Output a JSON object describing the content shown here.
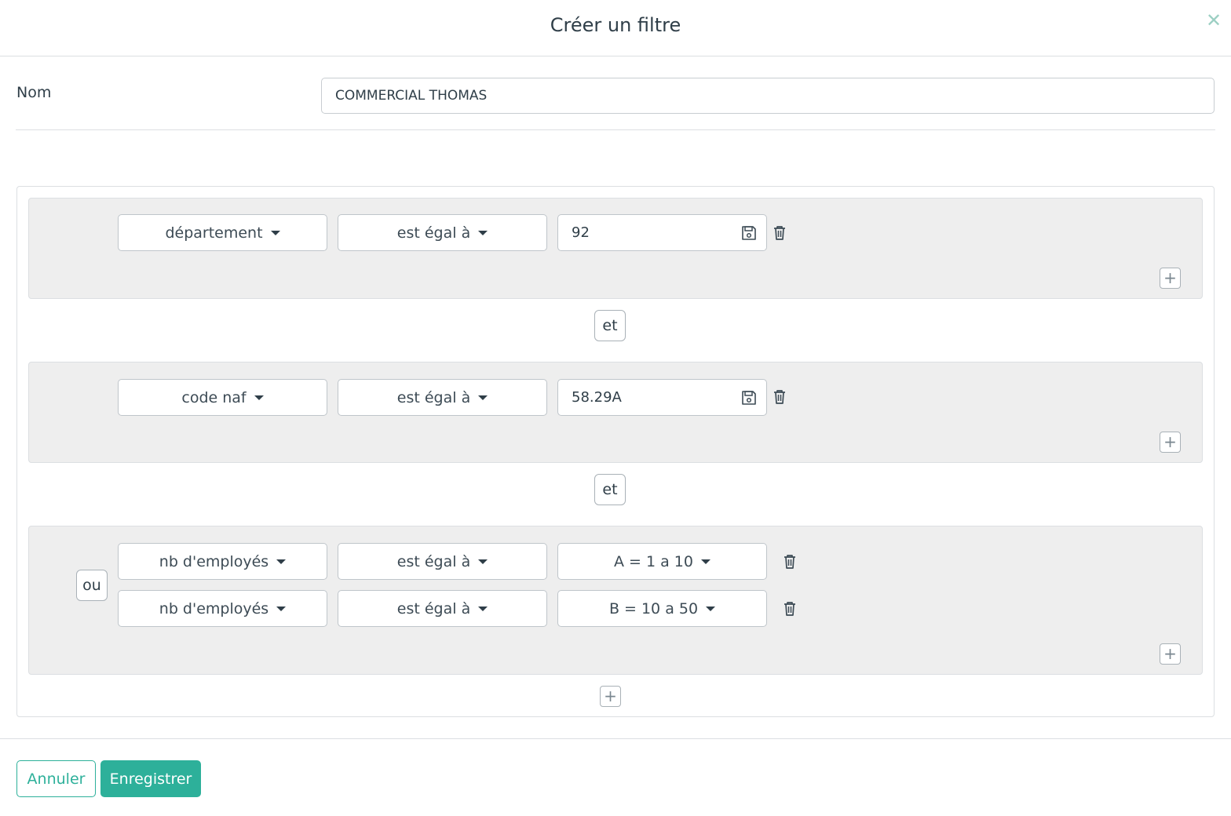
{
  "dialog": {
    "title": "Créer un filtre",
    "close_icon": "close-icon"
  },
  "form": {
    "name_label": "Nom",
    "name_value": "COMMERCIAL THOMAS"
  },
  "groups": [
    {
      "rules": [
        {
          "field": "département",
          "operator": "est égal à",
          "value": "92",
          "value_type": "text"
        }
      ]
    },
    {
      "rules": [
        {
          "field": "code naf",
          "operator": "est égal à",
          "value": "58.29A",
          "value_type": "text"
        }
      ]
    },
    {
      "combinator": "ou",
      "rules": [
        {
          "field": "nb d'employés",
          "operator": "est égal à",
          "value": "A = 1 a 10",
          "value_type": "select"
        },
        {
          "field": "nb d'employés",
          "operator": "est égal à",
          "value": "B = 10 a 50",
          "value_type": "select"
        }
      ]
    }
  ],
  "connectors": [
    "et",
    "et"
  ],
  "add_symbol": "+",
  "footer": {
    "cancel_label": "Annuler",
    "save_label": "Enregistrer"
  },
  "colors": {
    "accent": "#2db09a",
    "text": "#2f3e48",
    "group_bg": "#eeeeee"
  }
}
